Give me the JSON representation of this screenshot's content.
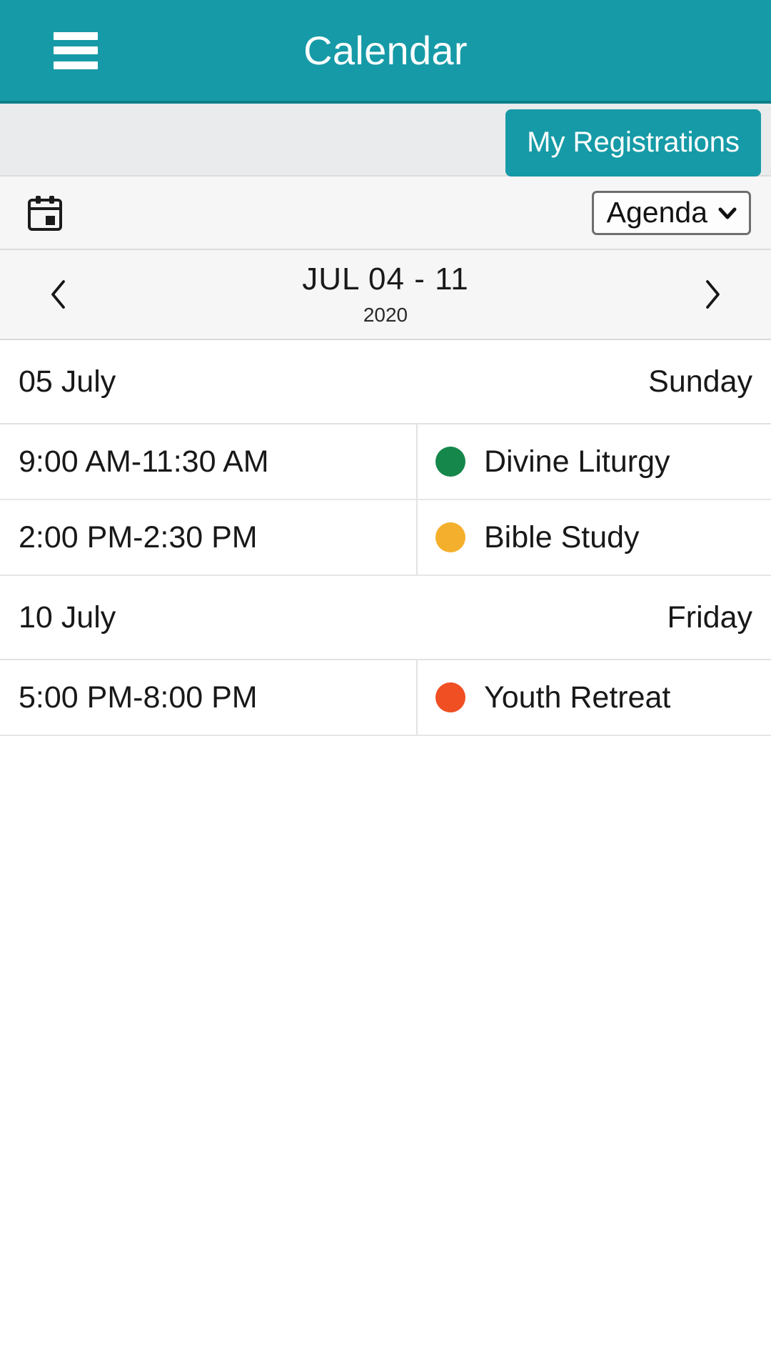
{
  "appbar": {
    "title": "Calendar",
    "menu_icon": "hamburger-menu-icon"
  },
  "subbar": {
    "registrations_label": "My Registrations"
  },
  "viewbar": {
    "calendar_icon": "calendar-icon",
    "view_select": {
      "selected": "Agenda",
      "chevron_icon": "chevron-down-icon",
      "options": [
        "Agenda"
      ]
    }
  },
  "date_nav": {
    "prev_icon": "chevron-left-icon",
    "next_icon": "chevron-right-icon",
    "range": "JUL 04 - 11",
    "year": "2020"
  },
  "agenda": {
    "days": [
      {
        "date": "05 July",
        "weekday": "Sunday",
        "events": [
          {
            "time": "9:00 AM-11:30 AM",
            "title": "Divine Liturgy",
            "color": "#15874B"
          },
          {
            "time": "2:00 PM-2:30 PM",
            "title": "Bible Study",
            "color": "#F4B02C"
          }
        ]
      },
      {
        "date": "10 July",
        "weekday": "Friday",
        "events": [
          {
            "time": "5:00 PM-8:00 PM",
            "title": "Youth Retreat",
            "color": "#F04E23"
          }
        ]
      }
    ]
  },
  "theme": {
    "accent": "#169AA7",
    "accent_dark": "#0E7E8B",
    "subbar_bg": "#E9EBEC",
    "toolbar_bg": "#F6F6F6",
    "text": "#181818",
    "divider": "#E2E2E2"
  }
}
